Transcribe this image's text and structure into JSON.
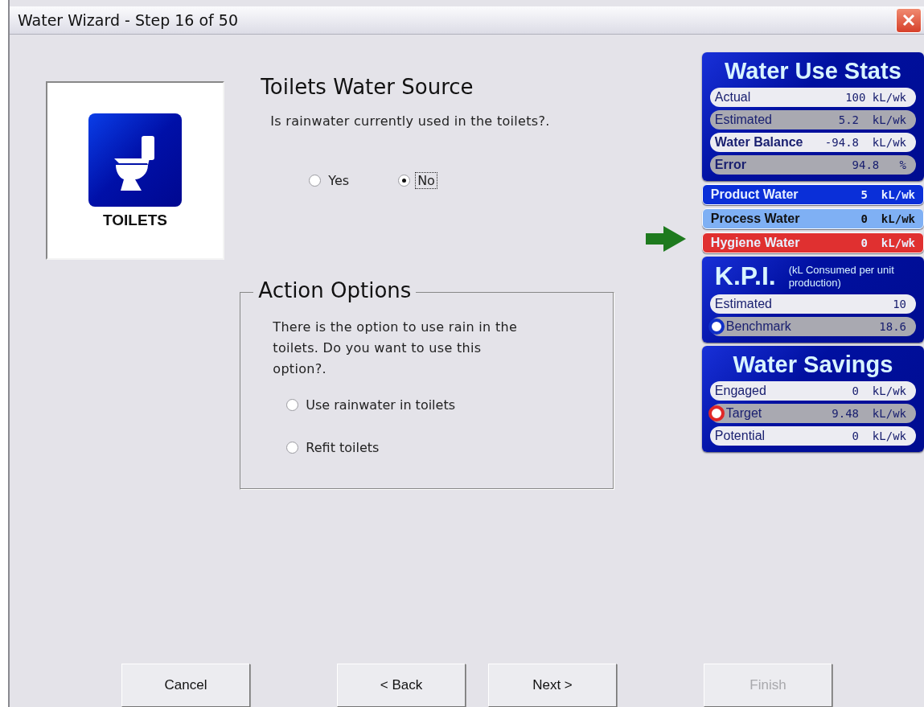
{
  "window": {
    "title": "Water Wizard - Step 16 of 50"
  },
  "category": {
    "label": "TOILETS"
  },
  "question": {
    "title": "Toilets Water Source",
    "text": "Is rainwater currently used in the toilets?.",
    "options": [
      {
        "label": "Yes",
        "selected": false,
        "focused": false
      },
      {
        "label": "No",
        "selected": true,
        "focused": true
      }
    ]
  },
  "action_options": {
    "title": "Action Options",
    "text": "There is the option to use rain in the toilets. Do you want to use this option?.",
    "options": [
      {
        "label": "Use rainwater in toilets",
        "selected": false
      },
      {
        "label": "Refit toilets",
        "selected": false
      }
    ]
  },
  "water_use_stats": {
    "title": "Water Use Stats",
    "rows": [
      {
        "label": "Actual",
        "value": "100 kL/wk",
        "bold": false
      },
      {
        "label": "Estimated",
        "value": "5.2  kL/wk",
        "bold": false
      },
      {
        "label": "Water Balance",
        "value": "-94.8  kL/wk",
        "bold": true
      },
      {
        "label": "Error",
        "value": "94.8   %",
        "bold": true
      }
    ]
  },
  "water_types": [
    {
      "label": "Product Water",
      "value": "5  kL/wk",
      "color": "#0a2fd8",
      "selected": false
    },
    {
      "label": "Process Water",
      "value": "0  kL/wk",
      "color": "#7fb0f4",
      "selected": false
    },
    {
      "label": "Hygiene Water",
      "value": "0  kL/wk",
      "color": "#e03030",
      "selected": true
    }
  ],
  "kpi": {
    "title": "K.P.I.",
    "note": "(kL Consumed per unit production)",
    "rows": [
      {
        "label": "Estimated",
        "value": "10"
      },
      {
        "label": "Benchmark",
        "value": "18.6",
        "color": "#1030c8"
      }
    ]
  },
  "water_savings": {
    "title": "Water Savings",
    "rows": [
      {
        "label": "Engaged",
        "value": "0  kL/wk"
      },
      {
        "label": "Target",
        "value": "9.48  kL/wk",
        "color": "#e02828"
      },
      {
        "label": "Potential",
        "value": "0  kL/wk"
      }
    ]
  },
  "buttons": [
    {
      "label": "Cancel",
      "disabled": false
    },
    {
      "label": "< Back",
      "disabled": false
    },
    {
      "label": "Next >",
      "disabled": false
    },
    {
      "label": "Finish",
      "disabled": true
    }
  ]
}
